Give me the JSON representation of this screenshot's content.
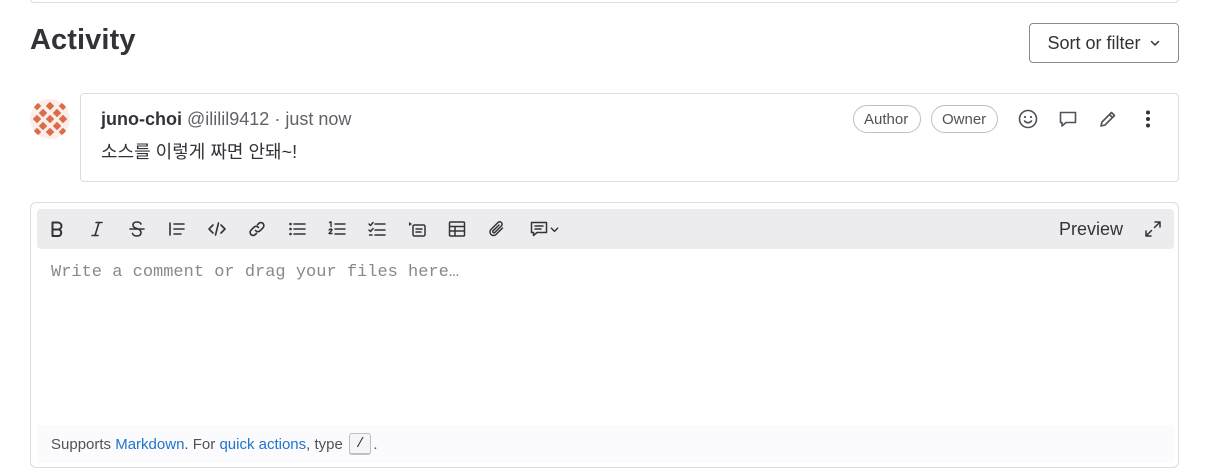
{
  "activity": {
    "title": "Activity",
    "sort_label": "Sort or filter"
  },
  "note": {
    "author_name": "juno-choi",
    "author_handle": "@ililil9412",
    "separator": "·",
    "timestamp": "just now",
    "body": "소스를 이렇게 짜면 안돼~!",
    "badges": [
      "Author",
      "Owner"
    ],
    "actions": [
      "emoji-reaction",
      "reply",
      "edit",
      "more-actions"
    ]
  },
  "editor": {
    "toolbar": [
      "bold",
      "italic",
      "strikethrough",
      "quote",
      "code",
      "link",
      "bullet-list",
      "numbered-list",
      "task-list",
      "collapsible-section",
      "table",
      "attach-file",
      "comment-templates"
    ],
    "preview_label": "Preview",
    "placeholder": "Write a comment or drag your files here…",
    "footer": {
      "prefix": "Supports ",
      "markdown_link": "Markdown",
      "middle": ". For ",
      "quick_actions_link": "quick actions",
      "type_text": ", type",
      "slash_key": "/",
      "suffix": "."
    }
  },
  "colors": {
    "link": "#1f75cb",
    "border": "#dcdcde",
    "toolbar_bg": "#ececef",
    "avatar_primary": "#dc6b4a"
  }
}
